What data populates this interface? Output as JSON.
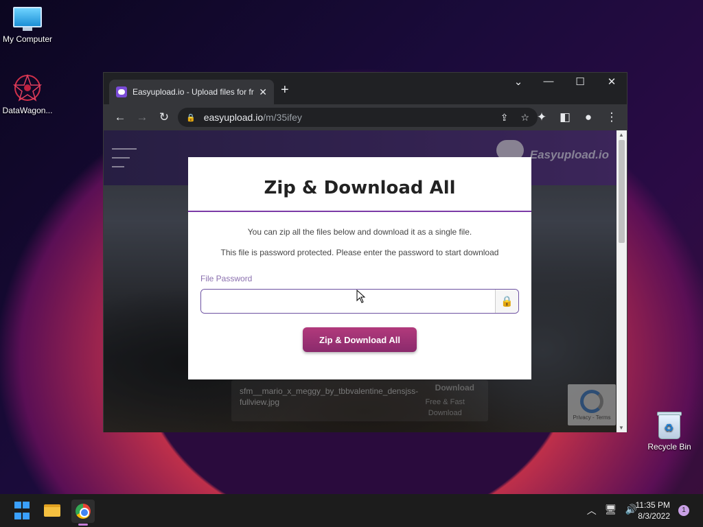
{
  "desktop": {
    "icons": [
      {
        "label": "My Computer"
      },
      {
        "label": "DataWagon..."
      },
      {
        "label": "Recycle Bin"
      }
    ]
  },
  "browser": {
    "tab_title": "Easyupload.io - Upload files for fr",
    "new_tab": "+",
    "url_host": "easyupload.io",
    "url_path": "/m/35ifey"
  },
  "site": {
    "brand": "Easyupload.io",
    "file_name": "sfm__mario_x_meggy_by_tbbvalentine_densjss-fullview.jpg",
    "download_label": "Download",
    "free_fast": "Free & Fast",
    "free_fast_2": "Download",
    "captcha_text": "Privacy - Terms"
  },
  "modal": {
    "title": "Zip & Download All",
    "desc1": "You can zip all the files below and download it as a single file.",
    "desc2": "This file is password protected. Please enter the password to start download",
    "password_label": "File Password",
    "password_value": "",
    "button_label": "Zip & Download All"
  },
  "taskbar": {
    "time": "11:35 PM",
    "date": "8/3/2022",
    "notification_count": "1"
  }
}
